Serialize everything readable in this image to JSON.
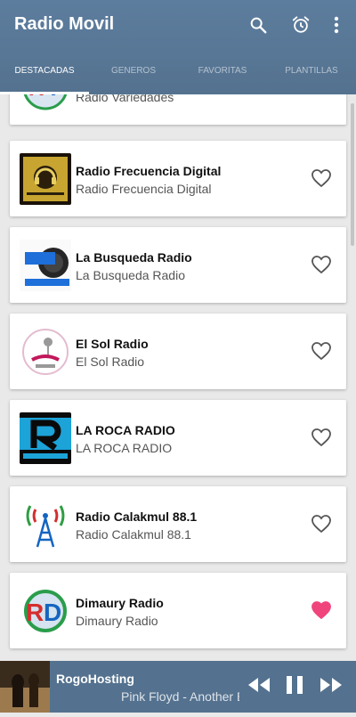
{
  "app": {
    "title": "Radio Movil"
  },
  "toolbar": {
    "search_icon": "search-icon",
    "alarm_icon": "alarm-icon",
    "more_icon": "more-vert-icon"
  },
  "tabs": [
    {
      "label": "DESTACADAS",
      "active": true
    },
    {
      "label": "GENEROS",
      "active": false
    },
    {
      "label": "FAVORITAS",
      "active": false
    },
    {
      "label": "PLANTILLAS",
      "active": false
    }
  ],
  "stations": [
    {
      "name": "",
      "subtitle": "Radio Variedades",
      "favorite": false
    },
    {
      "name": "Radio Frecuencia Digital",
      "subtitle": "Radio Frecuencia Digital",
      "favorite": false
    },
    {
      "name": "La Busqueda Radio",
      "subtitle": "La Busqueda Radio",
      "favorite": false
    },
    {
      "name": "El Sol Radio",
      "subtitle": "El Sol Radio",
      "favorite": false
    },
    {
      "name": "LA ROCA RADIO",
      "subtitle": "LA ROCA RADIO",
      "favorite": false
    },
    {
      "name": "Radio Calakmul 88.1",
      "subtitle": "Radio Calakmul 88.1",
      "favorite": false
    },
    {
      "name": "Dimaury Radio",
      "subtitle": "Dimaury Radio",
      "favorite": true
    }
  ],
  "player": {
    "title": "RogoHosting",
    "meta": "Pink Floyd - Another Brick in the Wall"
  },
  "colors": {
    "appbar": "#5d7d9e",
    "accent_heart": "#f0447c",
    "heart_outline": "#555555"
  }
}
